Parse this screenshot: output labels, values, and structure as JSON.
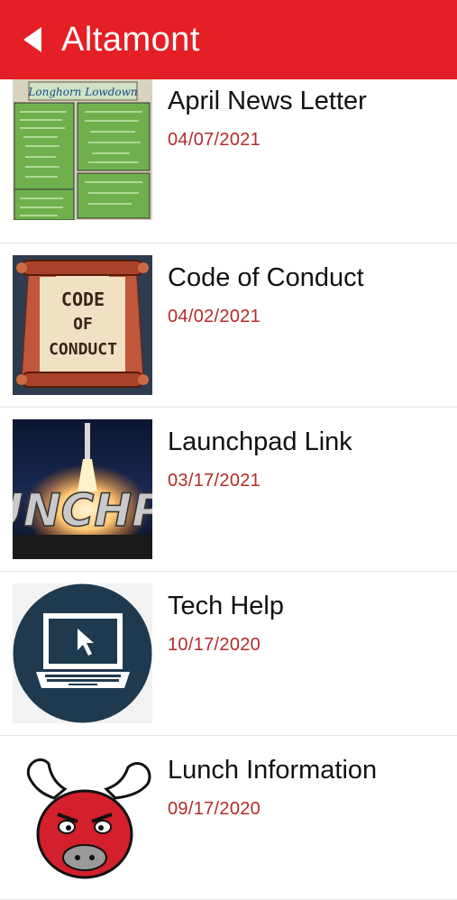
{
  "header": {
    "title": "Altamont",
    "back_icon": "back-arrow-icon"
  },
  "items": [
    {
      "title": "April News Letter",
      "date": "04/07/2021",
      "thumb": "newsletter-thumbnail",
      "thumb_text": "Longhorn Lowdown"
    },
    {
      "title": "Code of Conduct",
      "date": "04/02/2021",
      "thumb": "code-of-conduct-thumbnail",
      "thumb_text": "CODE OF CONDUCT"
    },
    {
      "title": "Launchpad Link",
      "date": "03/17/2021",
      "thumb": "launchpad-rocket-thumbnail",
      "thumb_text": "UNCHP"
    },
    {
      "title": "Tech Help",
      "date": "10/17/2020",
      "thumb": "laptop-icon"
    },
    {
      "title": "Lunch Information",
      "date": "09/17/2020",
      "thumb": "longhorn-mascot-thumbnail"
    }
  ],
  "colors": {
    "header": "#e41f25",
    "date": "#b52a2a"
  }
}
